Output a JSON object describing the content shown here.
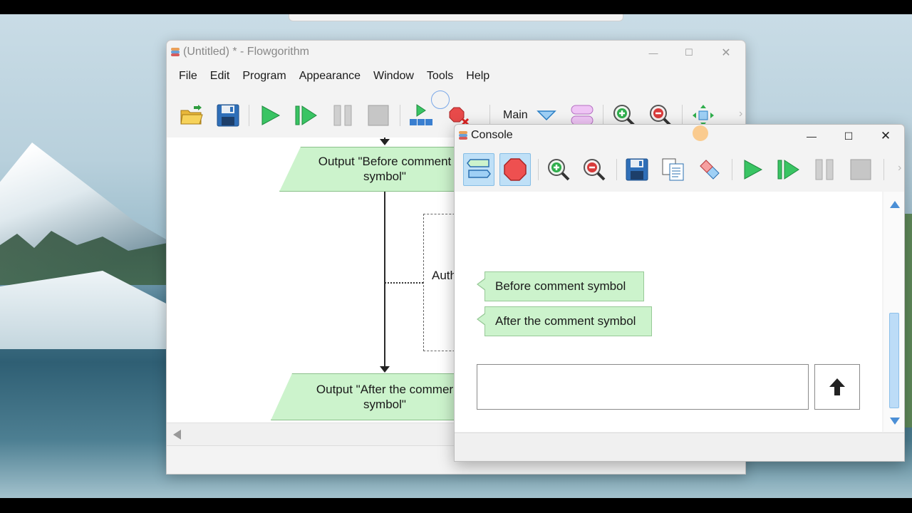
{
  "main_window": {
    "title": "(Untitled) * - Flowgorithm",
    "menu": [
      "File",
      "Edit",
      "Program",
      "Appearance",
      "Window",
      "Tools",
      "Help"
    ],
    "function_selector": "Main",
    "toolbar_icons": [
      "open-folder-icon",
      "save-icon",
      "run-icon",
      "step-icon",
      "pause-icon",
      "stop-icon",
      "breakpoint-run-icon",
      "clear-breakpoints-icon",
      "function-dropdown-icon",
      "add-function-icon",
      "zoom-in-icon",
      "zoom-out-icon",
      "fit-icon"
    ]
  },
  "flowchart": {
    "output1_line1": "Output \"Before comment",
    "output1_line2": "symbol\"",
    "comment_fragment": "Auth",
    "output2_line1": "Output \"After the commer",
    "output2_line2": "symbol\""
  },
  "console": {
    "title": "Console",
    "messages": [
      "Before comment symbol",
      "After the comment symbol"
    ],
    "input_value": "",
    "toolbar_icons": [
      "console-chat-view-icon",
      "console-stop-icon",
      "zoom-in-icon",
      "zoom-out-icon",
      "save-icon",
      "copy-icon",
      "clear-icon",
      "run-icon",
      "step-icon",
      "pause-icon",
      "stop-icon"
    ]
  },
  "colors": {
    "flow_green": "#ccf3cc",
    "accent_blue": "#bfe0f7",
    "run_green": "#2fbf5a"
  }
}
